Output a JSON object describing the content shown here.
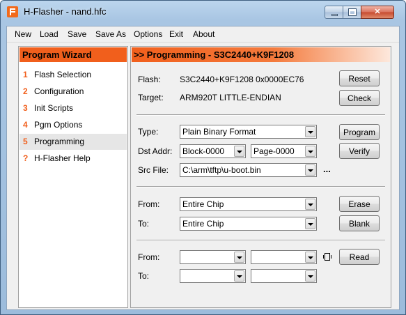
{
  "window": {
    "title": "H-Flasher - nand.hfc"
  },
  "menu": [
    "New",
    "Load",
    "Save",
    "Save As",
    "Options",
    "Exit",
    "About"
  ],
  "sidebar": {
    "header": "Program Wizard",
    "items": [
      {
        "num": "1",
        "label": "Flash Selection"
      },
      {
        "num": "2",
        "label": "Configuration"
      },
      {
        "num": "3",
        "label": "Init Scripts"
      },
      {
        "num": "4",
        "label": "Pgm Options"
      },
      {
        "num": "5",
        "label": "Programming"
      },
      {
        "num": "?",
        "label": "H-Flasher Help"
      }
    ],
    "selected_index": 4
  },
  "main": {
    "header": ">> Programming - S3C2440+K9F1208",
    "info": {
      "flash_label": "Flash:",
      "flash_value": "S3C2440+K9F1208  0x0000EC76",
      "target_label": "Target:",
      "target_value": "ARM920T  LITTLE-ENDIAN",
      "reset_button": "Reset",
      "check_button": "Check"
    },
    "program": {
      "type_label": "Type:",
      "type_value": "Plain Binary Format",
      "dst_label": "Dst Addr:",
      "dst_block": "Block-0000",
      "dst_page": "Page-0000",
      "src_label": "Src File:",
      "src_value": "C:\\arm\\tftp\\u-boot.bin",
      "browse": "...",
      "program_button": "Program",
      "verify_button": "Verify"
    },
    "erase": {
      "from_label": "From:",
      "from_value": "Entire Chip",
      "to_label": "To:",
      "to_value": "Entire Chip",
      "erase_button": "Erase",
      "blank_button": "Blank"
    },
    "read": {
      "from_label": "From:",
      "to_label": "To:",
      "from_a": "",
      "from_b": "",
      "to_a": "",
      "to_b": "",
      "read_button": "Read"
    }
  }
}
